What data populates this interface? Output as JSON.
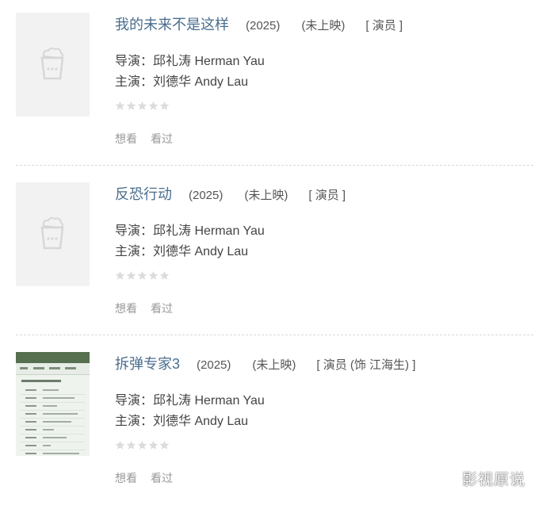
{
  "movies": [
    {
      "title": "我的未来不是这样",
      "year": "(2025)",
      "status": "(未上映)",
      "role": "[ 演员 ]",
      "director_line": "导演：邱礼涛 Herman Yau",
      "cast_line": "主演：刘德华 Andy Lau",
      "rating_stars": 0,
      "want_label": "想看",
      "seen_label": "看过",
      "poster": "placeholder"
    },
    {
      "title": "反恐行动",
      "year": "(2025)",
      "status": "(未上映)",
      "role": "[ 演员 ]",
      "director_line": "导演：邱礼涛 Herman Yau",
      "cast_line": "主演：刘德华 Andy Lau",
      "rating_stars": 0,
      "want_label": "想看",
      "seen_label": "看过",
      "poster": "placeholder"
    },
    {
      "title": "拆弹专家3",
      "year": "(2025)",
      "status": "(未上映)",
      "role": "[ 演员 (饰 江海生) ]",
      "director_line": "导演：邱礼涛 Herman Yau",
      "cast_line": "主演：刘德华 Andy Lau",
      "rating_stars": 0,
      "want_label": "想看",
      "seen_label": "看过",
      "poster": "document-screenshot"
    }
  ],
  "watermark": "影视原说",
  "colors": {
    "title_link": "#4a6e8e",
    "star_empty": "#dcdcdc",
    "action_text": "#999999",
    "poster_placeholder": "#f2f2f2"
  },
  "icons": {
    "placeholder": "popcorn-placeholder-icon",
    "rating": "star-icon"
  }
}
